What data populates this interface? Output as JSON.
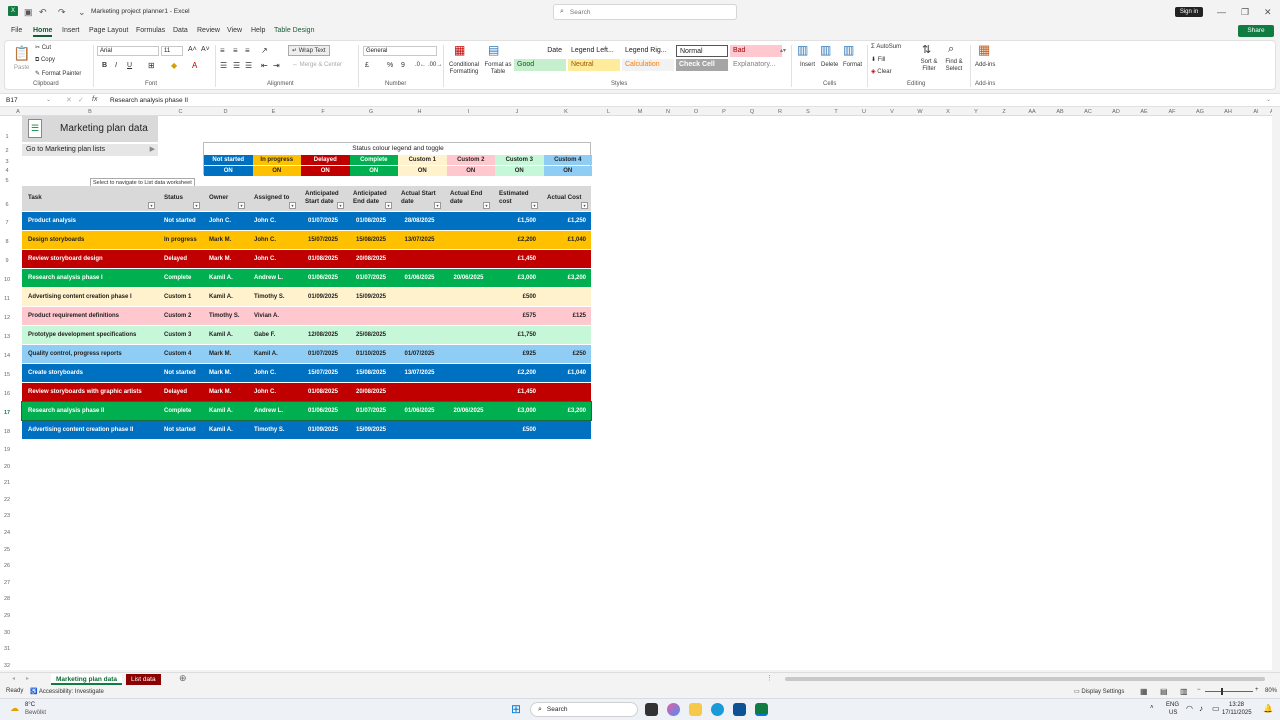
{
  "window": {
    "title": "Marketing project planner1 - Excel",
    "search_placeholder": "Search",
    "signin_label": "Sign in",
    "share_label": "Share"
  },
  "menu": [
    "File",
    "Home",
    "Insert",
    "Page Layout",
    "Formulas",
    "Data",
    "Review",
    "View",
    "Help",
    "Table Design"
  ],
  "ribbon": {
    "paste": "Paste",
    "cut": "Cut",
    "copy": "Copy",
    "format_painter": "Format Painter",
    "font_name": "Arial",
    "font_size": "11",
    "bold": "B",
    "italic": "I",
    "underline": "U",
    "wrap_text": "Wrap Text",
    "merge_center": "Merge & Center",
    "number_format": "General",
    "conditional_formatting": "Conditional Formatting",
    "format_as_table": "Format as Table",
    "styles": [
      {
        "label": "Date",
        "bg": "#ffffff",
        "fg": "#222222"
      },
      {
        "label": "Legend Left...",
        "bg": "#ffffff",
        "fg": "#222222"
      },
      {
        "label": "Legend Rig...",
        "bg": "#ffffff",
        "fg": "#222222"
      },
      {
        "label": "Normal",
        "bg": "#ffffff",
        "fg": "#222222"
      },
      {
        "label": "Bad",
        "bg": "#ffc7ce",
        "fg": "#9c0006"
      },
      {
        "label": "Good",
        "bg": "#c6efce",
        "fg": "#006100"
      },
      {
        "label": "Neutral",
        "bg": "#ffeb9c",
        "fg": "#9c5700"
      },
      {
        "label": "Calculation",
        "bg": "#f2f2f2",
        "fg": "#fa7d00"
      },
      {
        "label": "Check Cell",
        "bg": "#a5a5a5",
        "fg": "#ffffff"
      },
      {
        "label": "Explanatory...",
        "bg": "#ffffff",
        "fg": "#7f7f7f"
      }
    ],
    "insert": "Insert",
    "delete": "Delete",
    "format": "Format",
    "autosum": "AutoSum",
    "fill": "Fill",
    "clear": "Clear",
    "sort_filter": "Sort & Filter",
    "find_select": "Find & Select",
    "addins": "Add-ins",
    "groups": {
      "clipboard": "Clipboard",
      "font": "Font",
      "alignment": "Alignment",
      "number": "Number",
      "styles": "Styles",
      "cells": "Cells",
      "editing": "Editing",
      "addins": "Add-ins"
    }
  },
  "formula_bar": {
    "cell_ref": "B17",
    "fx": "fx",
    "content": "Research analysis phase II"
  },
  "columns": [
    "A",
    "B",
    "C",
    "D",
    "E",
    "F",
    "G",
    "H",
    "I",
    "J",
    "K",
    "L",
    "M",
    "N",
    "O",
    "P",
    "Q",
    "R",
    "S",
    "T",
    "U",
    "V",
    "W",
    "X",
    "Y",
    "Z",
    "AA",
    "AB",
    "AC",
    "AD",
    "AE",
    "AF",
    "AG",
    "AH",
    "AI",
    "AJ"
  ],
  "sheet": {
    "title": "Marketing plan data",
    "goto_label": "Go to Marketing plan lists",
    "tooltip": "Select to navigate to List data worksheet"
  },
  "legend": {
    "title": "Status colour legend and toggle",
    "items": [
      {
        "label": "Not started",
        "bg": "#0070c0",
        "fg": "#ffffff",
        "toggle": "ON"
      },
      {
        "label": "In progress",
        "bg": "#ffc000",
        "fg": "#222222",
        "toggle": "ON"
      },
      {
        "label": "Delayed",
        "bg": "#c00000",
        "fg": "#ffffff",
        "toggle": "ON"
      },
      {
        "label": "Complete",
        "bg": "#00b050",
        "fg": "#ffffff",
        "toggle": "ON"
      },
      {
        "label": "Custom 1",
        "bg": "#fff2cc",
        "fg": "#222222",
        "toggle": "ON"
      },
      {
        "label": "Custom 2",
        "bg": "#ffc7ce",
        "fg": "#222222",
        "toggle": "ON"
      },
      {
        "label": "Custom 3",
        "bg": "#c6f7d8",
        "fg": "#222222",
        "toggle": "ON"
      },
      {
        "label": "Custom 4",
        "bg": "#8fcdf5",
        "fg": "#222222",
        "toggle": "ON"
      }
    ]
  },
  "table": {
    "headers": [
      "Task",
      "Status",
      "Owner",
      "Assigned to",
      "Anticipated Start date",
      "Anticipated End date",
      "Actual Start date",
      "Actual End date",
      "Estimated cost",
      "Actual Cost"
    ],
    "rows": [
      {
        "task": "Product analysis",
        "status": "Not started",
        "owner": "John C.",
        "assigned": "John C.",
        "ant_start": "01/07/2025",
        "ant_end": "01/08/2025",
        "act_start": "28/08/2025",
        "act_end": "",
        "est": "£1,500",
        "act": "£1,250",
        "bg": "#0070c0",
        "fg": "#ffffff"
      },
      {
        "task": "Design storyboards",
        "status": "In progress",
        "owner": "Mark M.",
        "assigned": "John C.",
        "ant_start": "15/07/2025",
        "ant_end": "15/08/2025",
        "act_start": "13/07/2025",
        "act_end": "",
        "est": "£2,200",
        "act": "£1,040",
        "bg": "#ffc000",
        "fg": "#222222"
      },
      {
        "task": "Review storyboard design",
        "status": "Delayed",
        "owner": "Mark M.",
        "assigned": "John C.",
        "ant_start": "01/08/2025",
        "ant_end": "20/08/2025",
        "act_start": "",
        "act_end": "",
        "est": "£1,450",
        "act": "",
        "bg": "#c00000",
        "fg": "#ffffff"
      },
      {
        "task": "Research analysis phase I",
        "status": "Complete",
        "owner": "Kamil A.",
        "assigned": "Andrew L.",
        "ant_start": "01/06/2025",
        "ant_end": "01/07/2025",
        "act_start": "01/06/2025",
        "act_end": "20/06/2025",
        "est": "£3,000",
        "act": "£3,200",
        "bg": "#00b050",
        "fg": "#ffffff"
      },
      {
        "task": "Advertising content creation phase I",
        "status": "Custom 1",
        "owner": "Kamil A.",
        "assigned": "Timothy S.",
        "ant_start": "01/09/2025",
        "ant_end": "15/09/2025",
        "act_start": "",
        "act_end": "",
        "est": "£500",
        "act": "",
        "bg": "#fff2cc",
        "fg": "#222222"
      },
      {
        "task": "Product requirement definitions",
        "status": "Custom 2",
        "owner": "Timothy S.",
        "assigned": "Vivian A.",
        "ant_start": "",
        "ant_end": "",
        "act_start": "",
        "act_end": "",
        "est": "£575",
        "act": "£125",
        "bg": "#ffc7ce",
        "fg": "#222222"
      },
      {
        "task": "Prototype development specifications",
        "status": "Custom 3",
        "owner": "Kamil A.",
        "assigned": "Gabe F.",
        "ant_start": "12/08/2025",
        "ant_end": "25/08/2025",
        "act_start": "",
        "act_end": "",
        "est": "£1,750",
        "act": "",
        "bg": "#c6f7d8",
        "fg": "#222222"
      },
      {
        "task": "Quality control, progress reports",
        "status": "Custom 4",
        "owner": "Mark M.",
        "assigned": "Kamil A.",
        "ant_start": "01/07/2025",
        "ant_end": "01/10/2025",
        "act_start": "01/07/2025",
        "act_end": "",
        "est": "£925",
        "act": "£250",
        "bg": "#8fcdf5",
        "fg": "#222222"
      },
      {
        "task": "Create storyboards",
        "status": "Not started",
        "owner": "Mark M.",
        "assigned": "John C.",
        "ant_start": "15/07/2025",
        "ant_end": "15/08/2025",
        "act_start": "13/07/2025",
        "act_end": "",
        "est": "£2,200",
        "act": "£1,040",
        "bg": "#0070c0",
        "fg": "#ffffff"
      },
      {
        "task": "Review storyboards with graphic artists",
        "status": "Delayed",
        "owner": "Mark M.",
        "assigned": "John C.",
        "ant_start": "01/08/2025",
        "ant_end": "20/08/2025",
        "act_start": "",
        "act_end": "",
        "est": "£1,450",
        "act": "",
        "bg": "#c00000",
        "fg": "#ffffff"
      },
      {
        "task": "Research analysis phase II",
        "status": "Complete",
        "owner": "Kamil A.",
        "assigned": "Andrew L.",
        "ant_start": "01/06/2025",
        "ant_end": "01/07/2025",
        "act_start": "01/06/2025",
        "act_end": "20/06/2025",
        "est": "£3,000",
        "act": "£3,200",
        "bg": "#00b050",
        "fg": "#ffffff"
      },
      {
        "task": "Advertising content creation phase II",
        "status": "Not started",
        "owner": "Kamil A.",
        "assigned": "Timothy S.",
        "ant_start": "01/09/2025",
        "ant_end": "15/09/2025",
        "act_start": "",
        "act_end": "",
        "est": "£500",
        "act": "",
        "bg": "#0070c0",
        "fg": "#ffffff"
      }
    ]
  },
  "tabs": [
    {
      "label": "Marketing plan data",
      "active": true
    },
    {
      "label": "List data",
      "active": false
    }
  ],
  "status": {
    "ready": "Ready",
    "accessibility": "Accessibility: Investigate",
    "display_settings": "Display Settings",
    "zoom": "80%"
  },
  "taskbar": {
    "weather_temp": "8°C",
    "weather_desc": "Bewölkt",
    "search": "Search",
    "lang": "ENG",
    "region": "US",
    "time": "13:28",
    "date": "17/11/2025"
  }
}
